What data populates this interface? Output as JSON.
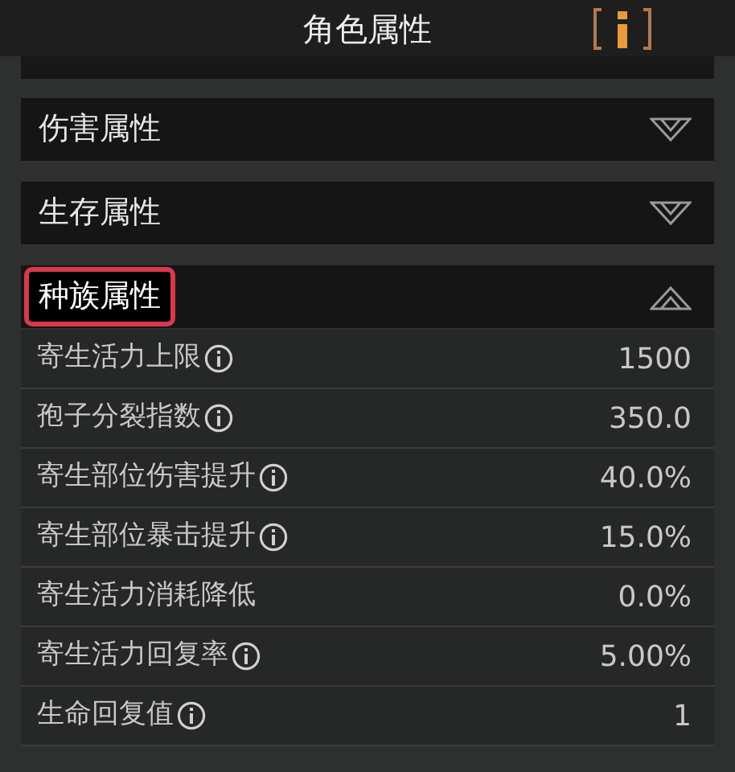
{
  "window": {
    "title": "角色属性"
  },
  "sections": [
    {
      "title": "伤害属性",
      "expanded": false,
      "highlighted": false
    },
    {
      "title": "生存属性",
      "expanded": false,
      "highlighted": false
    },
    {
      "title": "种族属性",
      "expanded": true,
      "highlighted": true,
      "rows": [
        {
          "label": "寄生活力上限",
          "info": true,
          "value": "1500"
        },
        {
          "label": "孢子分裂指数",
          "info": true,
          "value": "350.0"
        },
        {
          "label": "寄生部位伤害提升",
          "info": true,
          "value": "40.0%"
        },
        {
          "label": "寄生部位暴击提升",
          "info": true,
          "value": "15.0%"
        },
        {
          "label": "寄生活力消耗降低",
          "info": false,
          "value": "0.0%"
        },
        {
          "label": "寄生活力回复率",
          "info": true,
          "value": "5.00%"
        },
        {
          "label": "生命回复值",
          "info": true,
          "value": "1"
        }
      ]
    }
  ]
}
